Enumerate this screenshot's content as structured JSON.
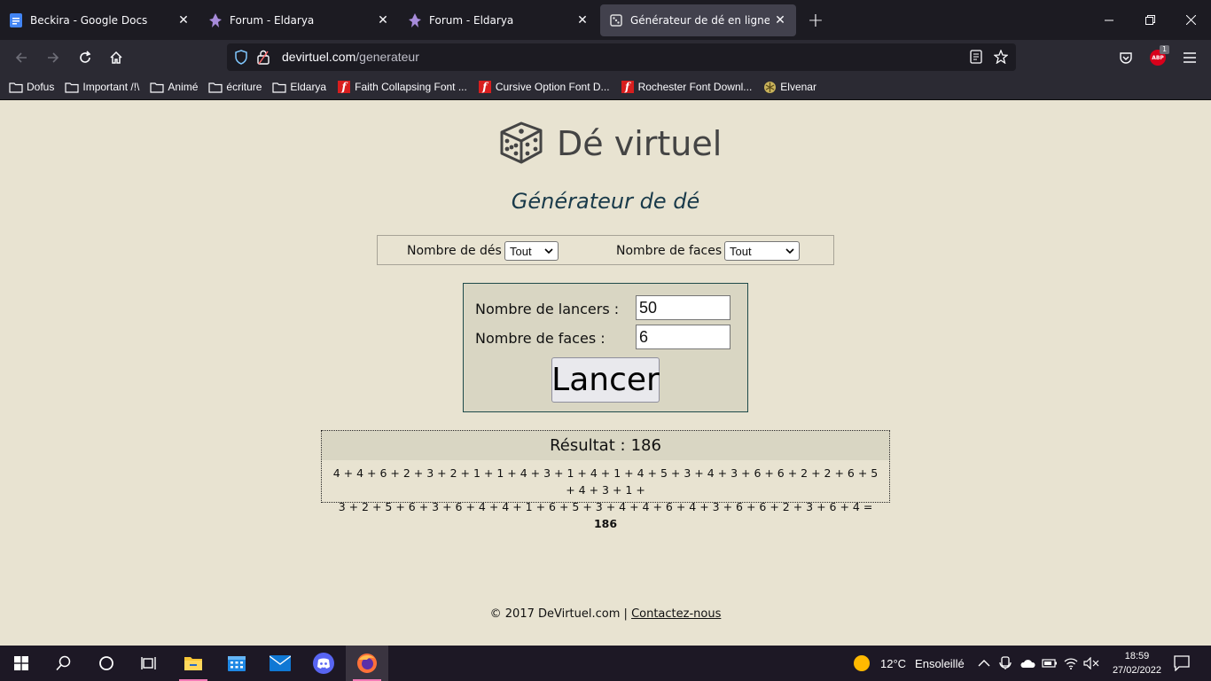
{
  "browser": {
    "tabs": [
      {
        "label": "Beckira - Google Docs",
        "icon": "google-docs-icon"
      },
      {
        "label": "Forum - Eldarya",
        "icon": "eldarya-icon"
      },
      {
        "label": "Forum - Eldarya",
        "icon": "eldarya-icon"
      },
      {
        "label": "Générateur de dé en ligne",
        "icon": "dice-icon",
        "active": true
      }
    ],
    "url_domain": "devirtuel.com",
    "url_path": "/generateur",
    "adblock_badge": "1",
    "adblock_label": "ABP",
    "bookmarks": [
      {
        "label": "Dofus",
        "icon": "folder-icon"
      },
      {
        "label": "Important /!\\",
        "icon": "folder-icon"
      },
      {
        "label": "Animé",
        "icon": "folder-icon"
      },
      {
        "label": "écriture",
        "icon": "folder-icon"
      },
      {
        "label": "Eldarya",
        "icon": "folder-icon"
      },
      {
        "label": "Faith Collapsing Font ...",
        "icon": "font-f-icon"
      },
      {
        "label": "Cursive Option Font D...",
        "icon": "font-f-icon"
      },
      {
        "label": "Rochester Font Downl...",
        "icon": "font-f-icon"
      },
      {
        "label": "Elvenar",
        "icon": "elvenar-icon"
      }
    ]
  },
  "page": {
    "logo_text": "Dé virtuel",
    "subtitle": "Générateur de dé",
    "filters": {
      "dice_label": "Nombre de dés :",
      "dice_value": "Tout",
      "faces_label": "Nombre de faces :",
      "faces_value": "Tout"
    },
    "form": {
      "rolls_label": "Nombre de lancers :",
      "rolls_value": "50",
      "faces_label": "Nombre de faces :",
      "faces_value": "6",
      "submit_label": "Lancer"
    },
    "result": {
      "label": "Résultat :",
      "total": "186",
      "line1": "4 + 4 + 6 + 2 + 3 + 2 + 1 + 1 + 4 + 3 + 1 + 4 + 1 + 4 + 5 + 3 + 4 + 3 + 6 + 6 + 2 + 2 + 6 + 5 + 4 + 3 + 1 +",
      "line2": "3 + 2 + 5 + 6 + 3 + 6 + 4 + 4 + 1 + 6 + 5 + 3 + 4 + 4 + 6 + 4 + 3 + 6 + 6 + 2 + 3 + 6 + 4 =",
      "sum": "186"
    },
    "footer": {
      "copyright": "© 2017 DeVirtuel.com |",
      "contact": "Contactez-nous"
    }
  },
  "taskbar": {
    "weather_temp": "12°C",
    "weather_desc": "Ensoleillé",
    "time": "18:59",
    "date": "27/02/2022"
  },
  "colors": {
    "page_bg": "#e8e3d1",
    "box_bg": "#d9d6c3",
    "subtitle": "#193a4a",
    "browser_dark": "#1c1b22",
    "toolbar": "#2b2a33"
  }
}
